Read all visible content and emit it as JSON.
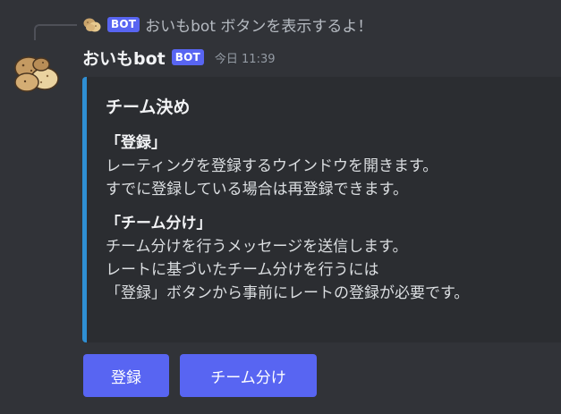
{
  "reply": {
    "avatar_icon": "potato-icon",
    "bot_tag": "BOT",
    "text": "おいもbot ボタンを表示するよ！"
  },
  "message": {
    "avatar_icon": "potato-icon",
    "username": "おいもbot",
    "bot_tag": "BOT",
    "timestamp": "今日 11:39"
  },
  "embed": {
    "accent_color": "#2f8fd3",
    "title": "チーム決め",
    "fields": [
      {
        "name": "「登録」",
        "lines": [
          "レーティングを登録するウインドウを開きます。",
          "すでに登録している場合は再登録できます。"
        ]
      },
      {
        "name": "「チーム分け」",
        "lines": [
          "チーム分けを行うメッセージを送信します。",
          "レートに基づいたチーム分けを行うには",
          "「登録」ボタンから事前にレートの登録が必要です。"
        ]
      }
    ]
  },
  "buttons": {
    "register_label": "登録",
    "team_split_label": "チーム分け",
    "color": "#5865f2"
  }
}
